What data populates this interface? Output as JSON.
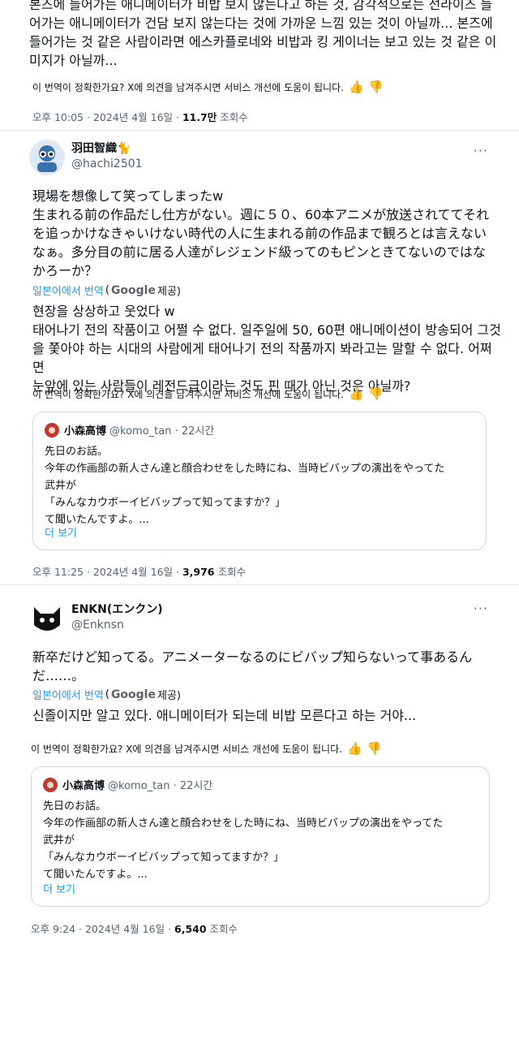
{
  "post1": {
    "text": "본즈에 들어가는 애니메이터가 비밥 보지 않는다고 하는 것, 감각적으로는 선라이즈 들\n어가는 애니메이터가 건담 보지 않는다는 것에 가까운 느낌 있는 것이 아닐까... 본즈에\n들어가는 것 같은 사람이라면 에스카플로네와 비밥과 킹 게이너는 보고 있는 것 같은 이\n미지가 아닐까...",
    "feedback": "이 번역이 정확한가요? X에 의견을 남겨주시면 서비스 개선에 도움이 됩니다.",
    "time": "오후 10:05 · 2024년 4월 16일 · ",
    "views": "11.7만",
    "views_label": " 조회수"
  },
  "post2": {
    "display_name": "羽田智織🐈",
    "username": "@hachi2501",
    "more": "···",
    "original": "現場を想像して笑ってしまったw\n生まれる前の作品だし仕方がない。週に５０、60本アニメが放送されててそれ\nを追っかけなきゃいけない時代の人に生まれる前の作品まで観ろとは言えない\nなぁ。多分目の前に居る人達がレジェンド級ってのもピンときてないのではな\nかろーか？",
    "translated_from": "일본어에서 번역",
    "paren_open": "(",
    "google": "Google",
    "provided": " 제공)",
    "translation": "현장을 상상하고 웃었다 w\n태어나기 전의 작품이고 어쩔 수 없다. 일주일에 50, 60편 애니메이션이 방송되어 그것\n을 쫓아야 하는 시대의 사람에게 태어나기 전의 작품까지 봐라고는 말할 수 없다. 어쩌면\n눈앞에 있는 사람들이 레전드급이라는 것도 핀 때가 아닌 것은 아닐까?",
    "feedback": "이 번역이 정확한가요? X에 의견을 남겨주시면 서비스 개선에 도움이 됩니다.",
    "quote": {
      "name": "小森高博",
      "handle": "@komo_tan · 22시간",
      "text": "先日のお話。\n今年の作画部の新人さん達と顔合わせをした時にね、当時ビバップの演出をやってた\n武井が\n「みんなカウボーイビバップって知ってますか？」\nて聞いたんですよ。...",
      "more": "더 보기"
    },
    "time": "오후 11:25 · 2024년 4월 16일 · ",
    "views": "3,976",
    "views_label": " 조회수"
  },
  "post3": {
    "display_name": "ENKN(エンクン)",
    "username": "@Enknsn",
    "more": "···",
    "original": "新卒だけど知ってる。アニメーターなるのにビバップ知らないって事あるん\nだ……。",
    "translated_from": "일본어에서 번역",
    "paren_open": "(",
    "google": "Google",
    "provided": " 제공)",
    "translation": "신졸이지만 알고 있다. 애니메이터가 되는데 비밥 모른다고 하는 거야...",
    "feedback": "이 번역이 정확한가요? X에 의견을 남겨주시면 서비스 개선에 도움이 됩니다.",
    "quote": {
      "name": "小森高博",
      "handle": "@komo_tan · 22시간",
      "text": "先日のお話。\n今年の作画部の新人さん達と顔合わせをした時にね、当時ビバップの演出をやってた\n武井が\n「みんなカウボーイビバップって知ってますか？」\nて聞いたんですよ。...",
      "more": "더 보기"
    },
    "time": "오후 9:24 · 2024년 4월 16일 · ",
    "views": "6,540",
    "views_label": " 조회수"
  },
  "colors": {
    "link": "#1d9bf0",
    "muted": "#536471",
    "text": "#0f1419",
    "border": "#cfd9de"
  },
  "icons": {
    "thumb_up": "thumbs-up-icon",
    "thumb_down": "thumbs-down-icon",
    "more": "more-icon"
  }
}
